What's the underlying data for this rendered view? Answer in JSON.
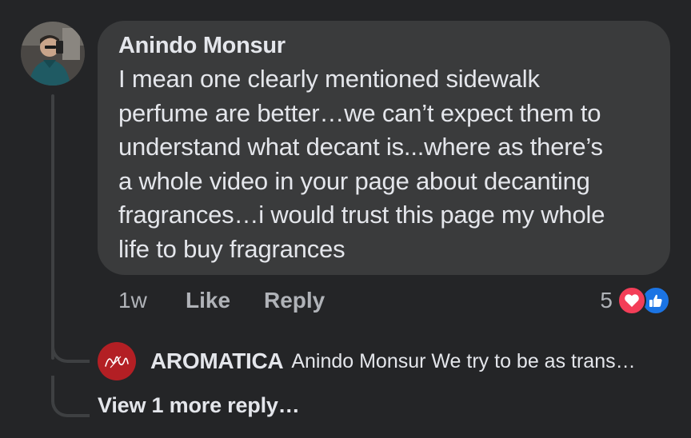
{
  "comment": {
    "author": "Anindo Monsur",
    "text": "I mean one clearly mentioned sidewalk\nperfume are better…we can’t expect them to\nunderstand what decant is...where as there’s\na whole video in your page  about decanting\nfragrances…i would trust this page my whole\nlife to buy fragrances",
    "avatar_icon": "user-avatar-photo"
  },
  "actions": {
    "time": "1w",
    "like_label": "Like",
    "reply_label": "Reply"
  },
  "reactions": {
    "count": "5",
    "icons": [
      "love-reaction-icon",
      "like-reaction-icon"
    ],
    "love_color": "#f33e58",
    "like_color": "#1b74e4"
  },
  "reply": {
    "author": "AROMATICA",
    "snippet": "Anindo Monsur We try to be as trans…",
    "avatar_color": "#b31f24"
  },
  "view_more_label": "View 1 more reply…",
  "theme": {
    "background": "#242527",
    "bubble": "#3a3b3c",
    "text": "#e4e6eb",
    "secondary_text": "#b0b3b8"
  }
}
